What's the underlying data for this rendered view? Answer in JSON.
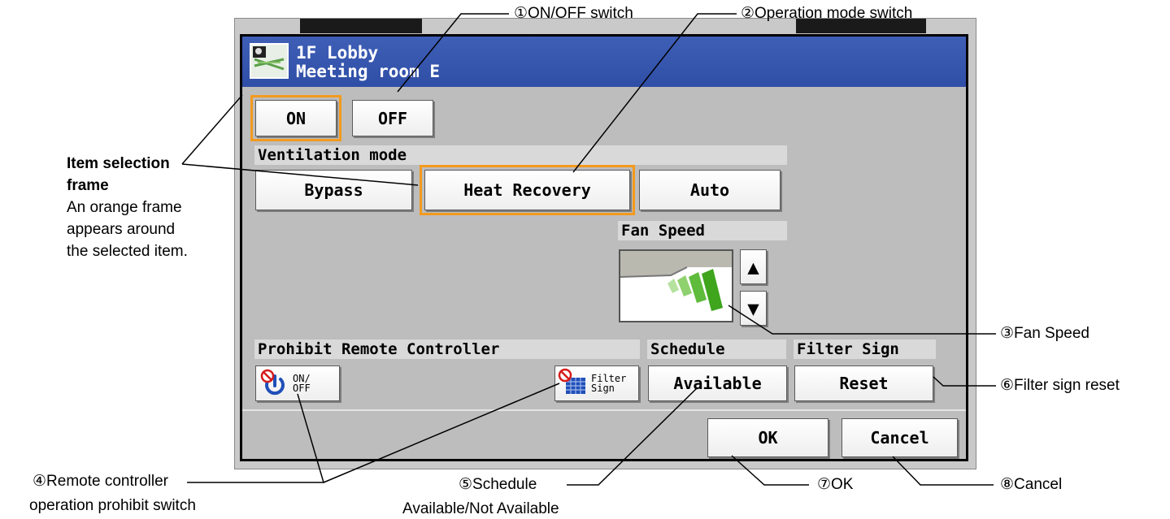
{
  "title": {
    "line1": "1F Lobby",
    "line2": "Meeting room E"
  },
  "onoff": {
    "on": "ON",
    "off": "OFF"
  },
  "ventilation": {
    "header": "Ventilation mode",
    "bypass": "Bypass",
    "heat_recovery": "Heat Recovery",
    "auto": "Auto"
  },
  "fan": {
    "header": "Fan Speed",
    "up": "▲",
    "down": "▼"
  },
  "prohibit": {
    "header": "Prohibit Remote Controller",
    "onoff_line1": "ON/",
    "onoff_line2": "OFF",
    "filter_line1": "Filter",
    "filter_line2": "Sign"
  },
  "schedule": {
    "header": "Schedule",
    "value": "Available"
  },
  "filter": {
    "header": "Filter Sign",
    "reset": "Reset"
  },
  "footer": {
    "ok": "OK",
    "cancel": "Cancel"
  },
  "annotations": {
    "on_off": "①ON/OFF switch",
    "mode": "②Operation mode switch",
    "fan": "③Fan Speed",
    "prohibit_1": "④Remote controller",
    "prohibit_2": "operation prohibit switch",
    "schedule_1": "⑤Schedule",
    "schedule_2": "Available/Not Available",
    "filter_reset": "⑥Filter sign reset",
    "ok": "⑦OK",
    "cancel": "⑧Cancel",
    "frame_title_1": "Item selection",
    "frame_title_2": "frame",
    "frame_desc_1": "An orange frame",
    "frame_desc_2": "appears around",
    "frame_desc_3": "the selected item."
  },
  "colors": {
    "titlebar": "#3456ad",
    "selection": "#f39a1e",
    "screen": "#bdbdbd"
  }
}
